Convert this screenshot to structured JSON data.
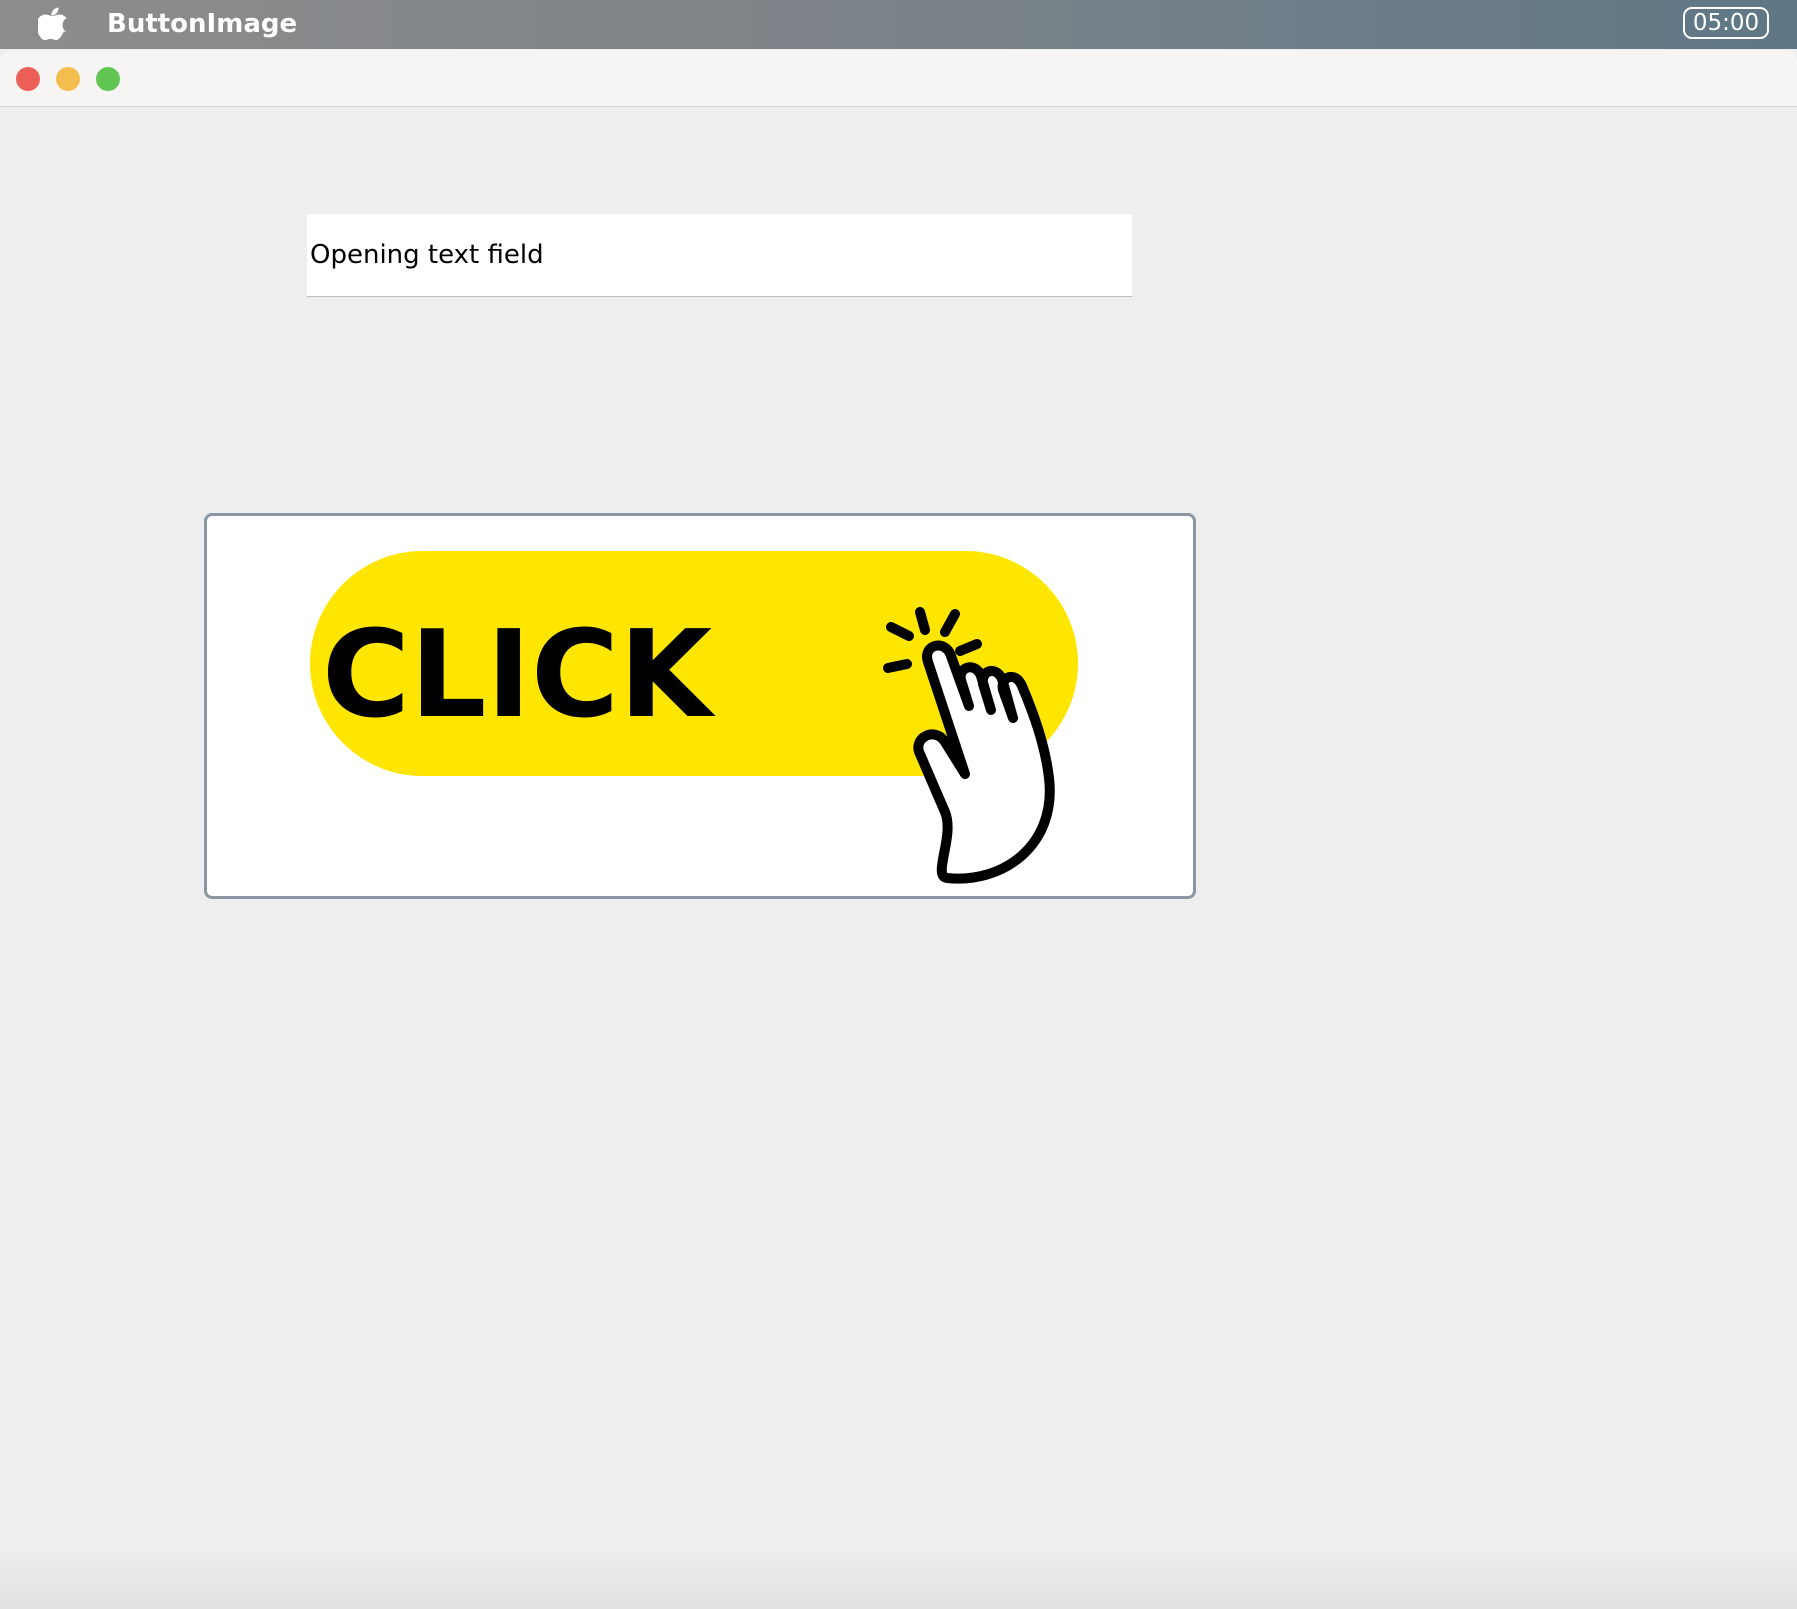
{
  "menubar": {
    "app_name": "ButtonImage",
    "clock": "05:00",
    "apple_icon": "apple-logo-icon"
  },
  "window": {
    "controls": [
      "close",
      "minimize",
      "zoom"
    ],
    "colors": {
      "close": "#ec5f57",
      "minimize": "#f4be4f",
      "zoom": "#61c554"
    }
  },
  "content": {
    "text_field": {
      "value": "Opening text field"
    },
    "image_button": {
      "label": "CLICK",
      "pill_color": "#ffe600",
      "icon": "pointing-hand-icon"
    }
  }
}
